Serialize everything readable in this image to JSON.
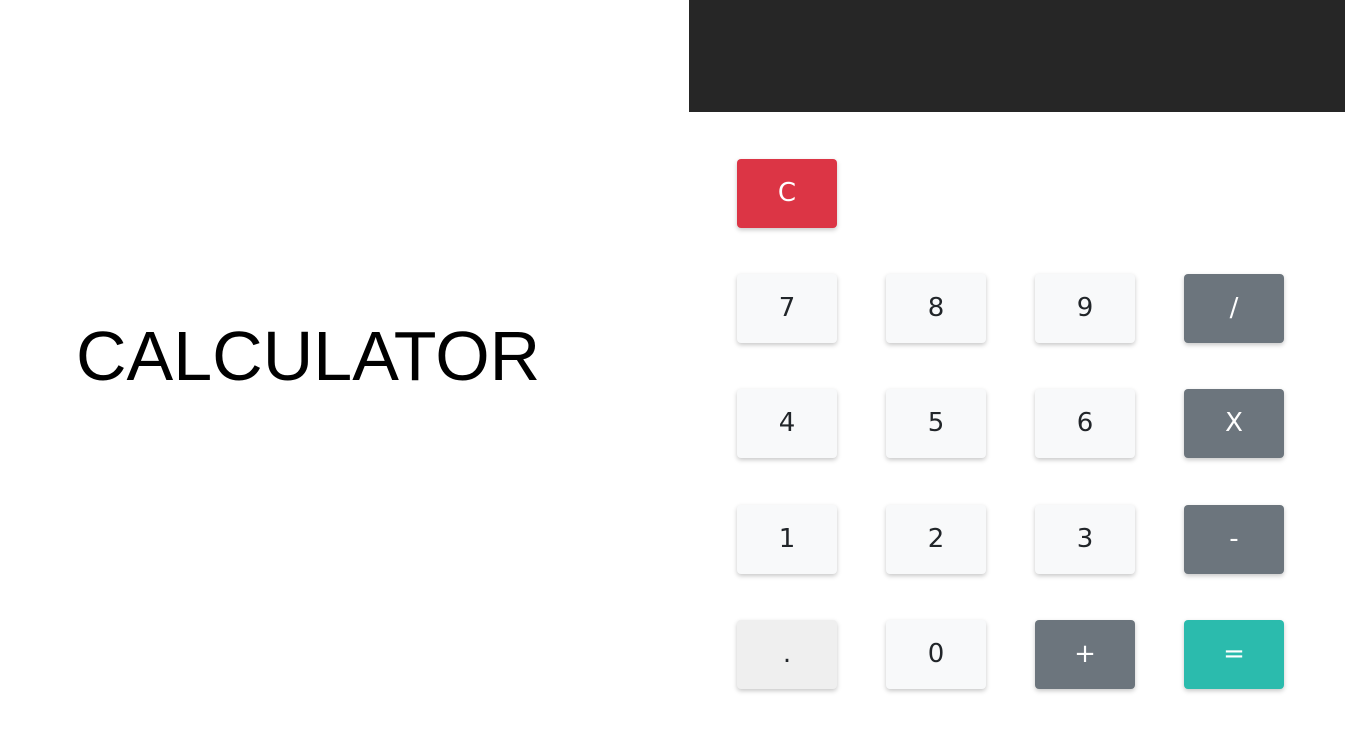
{
  "title": "CALCULATOR",
  "display": {
    "value": ""
  },
  "keys": {
    "clear": "C",
    "seven": "7",
    "eight": "8",
    "nine": "9",
    "divide": "/",
    "four": "4",
    "five": "5",
    "six": "6",
    "multiply": "X",
    "one": "1",
    "two": "2",
    "three": "3",
    "subtract": "-",
    "decimal": ".",
    "zero": "0",
    "add": "+",
    "equals": "="
  },
  "colors": {
    "display_bg": "#262626",
    "clear": "#dc3545",
    "operator": "#6c757d",
    "equals": "#2bbbad",
    "digit": "#f8f9fa"
  }
}
